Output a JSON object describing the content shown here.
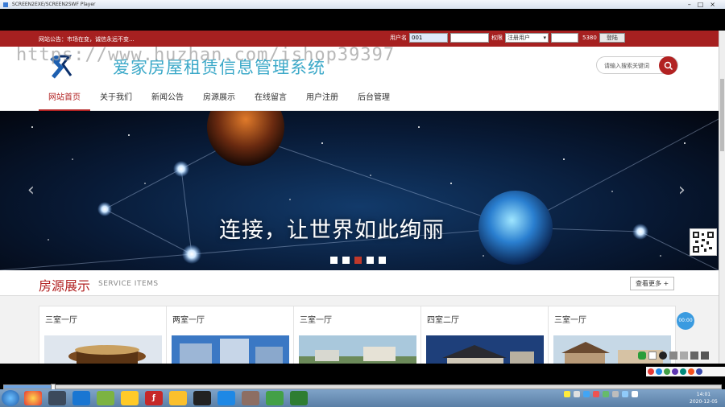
{
  "window": {
    "title": "SCREEN2EXE/SCREEN2SWF Player"
  },
  "topbar": {
    "notice": "网站公告：市场在变，诚信永远不变...",
    "username_label": "用户名",
    "username_value": "001",
    "role_label": "权限",
    "role_value": "注册用户",
    "captcha": "5380",
    "login_button": "登陆"
  },
  "watermark": "https://www.huzhan.com/ishop39397",
  "header": {
    "site_title": "爱家房屋租赁信息管理系统",
    "search_placeholder": "请输入搜索关键词"
  },
  "nav": {
    "items": [
      {
        "label": "网站首页",
        "active": true
      },
      {
        "label": "关于我们"
      },
      {
        "label": "新闻公告"
      },
      {
        "label": "房源展示"
      },
      {
        "label": "在线留言"
      },
      {
        "label": "用户注册"
      },
      {
        "label": "后台管理"
      }
    ]
  },
  "banner": {
    "slogan": "连接，让世界如此绚丽",
    "active_slide": 3,
    "slide_count": 5
  },
  "section": {
    "title": "房源展示",
    "subtitle": "SERVICE ITEMS",
    "more": "查看更多 +"
  },
  "cards": [
    {
      "title": "三室一厅"
    },
    {
      "title": "两室一厅"
    },
    {
      "title": "三室一厅"
    },
    {
      "title": "四室二厅"
    },
    {
      "title": "三室一厅"
    }
  ],
  "badge": "00:00",
  "clock": {
    "time": "14:01",
    "date": "2020-12-05"
  },
  "colors": {
    "brand_red": "#a62020",
    "title_blue": "#3aa8c8",
    "accent_red": "#b22222"
  }
}
